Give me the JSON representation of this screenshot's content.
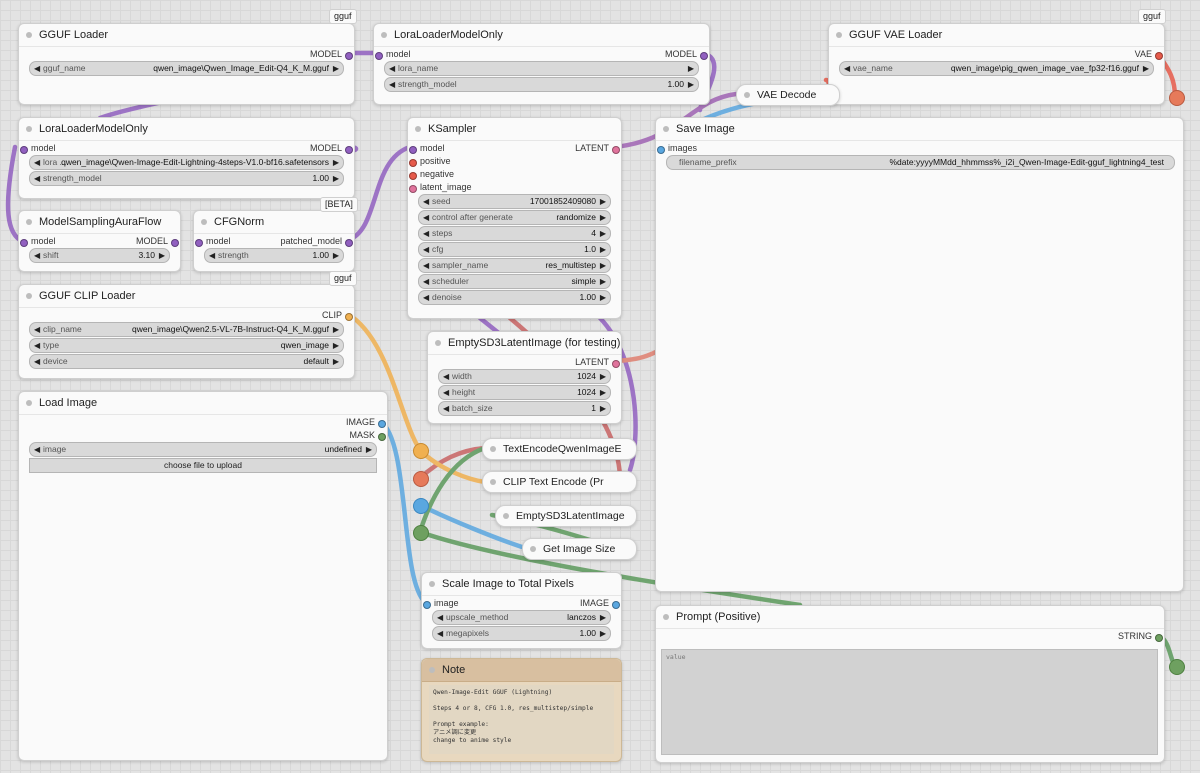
{
  "colors": {
    "model": "#9160c0",
    "latent": "#e0739c",
    "clip": "#f0b050",
    "vae": "#e65a4a",
    "image": "#5aa7e0",
    "mask": "#6ea060",
    "string": "#6ea060",
    "conditioning": "#c86464"
  },
  "nodes": {
    "gguf_loader": {
      "badge": "gguf",
      "title": "GGUF Loader",
      "out_model": "MODEL",
      "w_name": "gguf_name",
      "w_value": "qwen_image\\Qwen_Image_Edit-Q4_K_M.gguf"
    },
    "lora_top": {
      "title": "LoraLoaderModelOnly",
      "in_model": "model",
      "out_model": "MODEL",
      "w1_name": "lora_name",
      "w1_value": "",
      "w2_name": "strength_model",
      "w2_value": "1.00"
    },
    "gguf_vae": {
      "badge": "gguf",
      "title": "GGUF VAE Loader",
      "out_vae": "VAE",
      "w_name": "vae_name",
      "w_value": "qwen_image\\pig_qwen_image_vae_fp32-f16.gguf"
    },
    "vae_decode": {
      "title": "VAE Decode"
    },
    "lora_left": {
      "title": "LoraLoaderModelOnly",
      "in_model": "model",
      "out_model": "MODEL",
      "w1_name": "lora ...",
      "w1_value": "qwen_image\\Qwen-Image-Edit-Lightning-4steps-V1.0-bf16.safetensors",
      "w2_name": "strength_model",
      "w2_value": "1.00"
    },
    "ksampler": {
      "title": "KSampler",
      "in_model": "model",
      "in_positive": "positive",
      "in_negative": "negative",
      "in_latent": "latent_image",
      "out_latent": "LATENT",
      "widgets": [
        {
          "name": "seed",
          "value": "17001852409080"
        },
        {
          "name": "control after generate",
          "value": "randomize"
        },
        {
          "name": "steps",
          "value": "4"
        },
        {
          "name": "cfg",
          "value": "1.0"
        },
        {
          "name": "sampler_name",
          "value": "res_multistep"
        },
        {
          "name": "scheduler",
          "value": "simple"
        },
        {
          "name": "denoise",
          "value": "1.00"
        }
      ]
    },
    "save_image": {
      "title": "Save Image",
      "in_images": "images",
      "w_name": "filename_prefix",
      "w_value": "%date:yyyyMMdd_hhmmss%_i2i_Qwen-Image-Edit-gguf_lightning4_test"
    },
    "model_sampling": {
      "title": "ModelSamplingAuraFlow",
      "in_model": "model",
      "out_model": "MODEL",
      "w_name": "shift",
      "w_value": "3.10"
    },
    "cfgnorm": {
      "badge": "[BETA]",
      "title": "CFGNorm",
      "in_model": "model",
      "out_model": "patched_model",
      "w_name": "strength",
      "w_value": "1.00"
    },
    "clip_loader": {
      "badge": "gguf",
      "title": "GGUF CLIP Loader",
      "out_clip": "CLIP",
      "widgets": [
        {
          "name": "clip_name",
          "value": "qwen_image\\Qwen2.5-VL-7B-Instruct-Q4_K_M.gguf"
        },
        {
          "name": "type",
          "value": "qwen_image"
        },
        {
          "name": "device",
          "value": "default"
        }
      ]
    },
    "empty_sd3": {
      "title": "EmptySD3LatentImage (for testing)",
      "out_latent": "LATENT",
      "widgets": [
        {
          "name": "width",
          "value": "1024"
        },
        {
          "name": "height",
          "value": "1024"
        },
        {
          "name": "batch_size",
          "value": "1"
        }
      ]
    },
    "load_image": {
      "title": "Load Image",
      "out_image": "IMAGE",
      "out_mask": "MASK",
      "w_name": "image",
      "w_value": "undefined",
      "upload_label": "choose file to upload"
    },
    "text_encode_qwen": {
      "title": "TextEncodeQwenImageE"
    },
    "clip_text_encode": {
      "title": "CLIP Text Encode (Pr"
    },
    "empty_sd3_collapsed": {
      "title": "EmptySD3LatentImage"
    },
    "get_image_size": {
      "title": "Get Image Size"
    },
    "scale_image": {
      "title": "Scale Image to Total Pixels",
      "in_image": "image",
      "out_image": "IMAGE",
      "widgets": [
        {
          "name": "upscale_method",
          "value": "lanczos"
        },
        {
          "name": "megapixels",
          "value": "1.00"
        }
      ]
    },
    "prompt_positive": {
      "title": "Prompt (Positive)",
      "out_string": "STRING",
      "placeholder": "value"
    },
    "note": {
      "title": "Note",
      "text": "Qwen-Image-Edit GGUF (Lightning)\n\nSteps 4 or 8, CFG 1.0, res_multistep/simple\n\nPrompt example:\nアニメ調に変更\nchange to anime style"
    }
  }
}
